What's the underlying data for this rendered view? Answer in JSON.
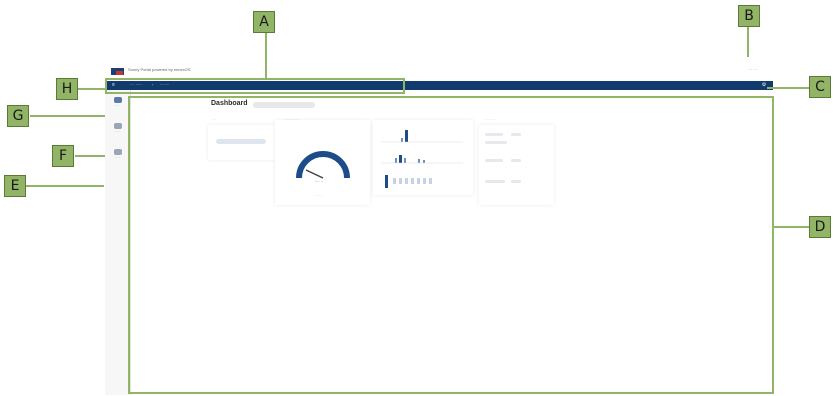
{
  "callouts": {
    "a": "A",
    "b": "B",
    "c": "C",
    "d": "D",
    "e": "E",
    "f": "F",
    "g": "G",
    "h": "H"
  },
  "header": {
    "title": "Sunny Portal powered by ennexOS",
    "user": "··· ···"
  },
  "nav": {
    "menu_icon": "menu-icon",
    "breadcrumb_1": "···· ······",
    "breadcrumb_sep": "›",
    "breadcrumb_2": "········",
    "action_icon": "gear-icon"
  },
  "sidebar": {
    "items": [
      {
        "label": "········",
        "icon": "dashboard-icon"
      },
      {
        "label": "········",
        "icon": "user-icon"
      },
      {
        "label": "········",
        "icon": "settings-icon"
      }
    ]
  },
  "dashboard": {
    "title": "Dashboard",
    "gauge": {
      "value_label": "···· ··",
      "subtitle": "········"
    },
    "section_labels": [
      "······",
      "··············",
      "·············"
    ]
  },
  "colors": {
    "callout": "#92b466",
    "nav": "#123b6d",
    "accent": "#1c4c8a"
  }
}
